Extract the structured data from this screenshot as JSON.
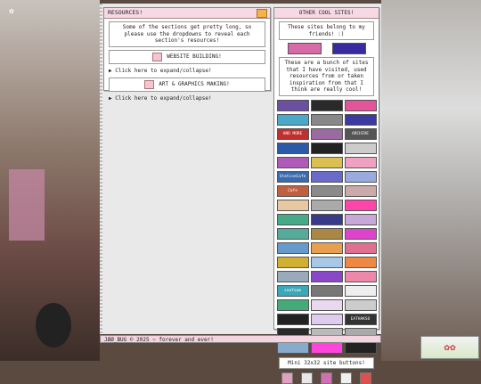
{
  "resources": {
    "title": "RESOURCES!",
    "intro": "Some of the sections get pretty long, so please use the dropdowns to reveal each section's resources!",
    "sections": [
      {
        "label": "WEBSITE BUILDING!",
        "toggle": "▶ Click here to expand/collapse!"
      },
      {
        "label": "ART & GRAPHICS MAKING!",
        "toggle": "▶ Click here to expand/collapse!"
      }
    ]
  },
  "cool": {
    "title": "OTHER COOL SITES!",
    "friends_text": "These sites belong to my friends! :)",
    "inspo_text": "These are a bunch of sites that I have visited, used resources from or taken inspiration from that I think are really cool!",
    "friend_buttons": [
      {
        "color": "#d96aa8"
      },
      {
        "color": "#3a2aa0"
      }
    ],
    "buttons": [
      {
        "text": "",
        "color": "#6b4fa0"
      },
      {
        "text": "",
        "color": "#2a2a2a"
      },
      {
        "text": "",
        "color": "#e2559a"
      },
      {
        "text": "",
        "color": "#4aa8c8"
      },
      {
        "text": "",
        "color": "#888"
      },
      {
        "text": "",
        "color": "#3a3aa0"
      },
      {
        "text": "AND MORE",
        "color": "#c03030"
      },
      {
        "text": "",
        "color": "#9a6aa0"
      },
      {
        "text": "ARCHIVE",
        "color": "#555"
      },
      {
        "text": "",
        "color": "#2a5aa8"
      },
      {
        "text": "",
        "color": "#222"
      },
      {
        "text": "",
        "color": "#ccc"
      },
      {
        "text": "",
        "color": "#b05ab8"
      },
      {
        "text": "",
        "color": "#d9c050"
      },
      {
        "text": "",
        "color": "#f0a0c0"
      },
      {
        "text": "StationCafe",
        "color": "#3a6ab0"
      },
      {
        "text": "",
        "color": "#6a6ac8"
      },
      {
        "text": "",
        "color": "#9ad"
      },
      {
        "text": "Cafe",
        "color": "#c06040"
      },
      {
        "text": "",
        "color": "#8a8a8a"
      },
      {
        "text": "",
        "color": "#caa"
      },
      {
        "text": "",
        "color": "#e8c8a0"
      },
      {
        "text": "",
        "color": "#aaa"
      },
      {
        "text": "",
        "color": "#f4a"
      },
      {
        "text": "",
        "color": "#4a8"
      },
      {
        "text": "",
        "color": "#3a3a8a"
      },
      {
        "text": "",
        "color": "#c8a8d8"
      },
      {
        "text": "",
        "color": "#5a9"
      },
      {
        "text": "",
        "color": "#a84"
      },
      {
        "text": "",
        "color": "#d4c"
      },
      {
        "text": "",
        "color": "#69c"
      },
      {
        "text": "",
        "color": "#e8a050"
      },
      {
        "text": "",
        "color": "#e07090"
      },
      {
        "text": "",
        "color": "#d0b030"
      },
      {
        "text": "",
        "color": "#a8c8e8"
      },
      {
        "text": "",
        "color": "#e84"
      },
      {
        "text": "",
        "color": "#9ab"
      },
      {
        "text": "",
        "color": "#8a48c8"
      },
      {
        "text": "",
        "color": "#e8a"
      },
      {
        "text": "seafoam",
        "color": "#3aa8b8"
      },
      {
        "text": "",
        "color": "#777"
      },
      {
        "text": "",
        "color": "#eee"
      },
      {
        "text": "",
        "color": "#4a7"
      },
      {
        "text": "",
        "color": "#e8d8f0"
      },
      {
        "text": "",
        "color": "#ccc"
      },
      {
        "text": "",
        "color": "#222"
      },
      {
        "text": "",
        "color": "#dce"
      },
      {
        "text": "EATHAKSO",
        "color": "#333"
      },
      {
        "text": "",
        "color": "#2a2a2a"
      },
      {
        "text": "",
        "color": "#bbb"
      },
      {
        "text": "",
        "color": "#aaa"
      },
      {
        "text": "",
        "color": "#8ac"
      },
      {
        "text": "",
        "color": "#f4d"
      },
      {
        "text": "",
        "color": "#222"
      }
    ],
    "mini_label": "Mini 32x32 site buttons!",
    "mini_buttons": [
      {
        "color": "#e0a0c0"
      },
      {
        "color": "#e8e8e8"
      },
      {
        "color": "#d070b0"
      },
      {
        "color": "#f0f0f0"
      },
      {
        "color": "#e05050"
      }
    ]
  },
  "footer": {
    "text": "JØØ_BUG © 2025 ~ forever and ever!"
  }
}
